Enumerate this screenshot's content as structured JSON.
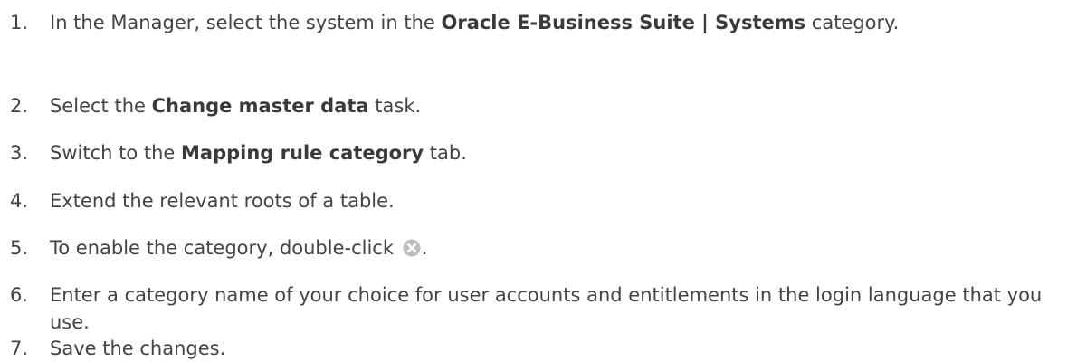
{
  "steps": [
    {
      "number": "1.",
      "text_before": "In the Manager, select the system in the ",
      "bold": "Oracle E-Business Suite | Systems",
      "text_after": " category."
    },
    {
      "number": "2.",
      "text_before": "Select the ",
      "bold": "Change master data",
      "text_after": " task."
    },
    {
      "number": "3.",
      "text_before": "Switch to the ",
      "bold": "Mapping rule category",
      "text_after": " tab."
    },
    {
      "number": "4.",
      "text": "Extend the relevant roots of a table."
    },
    {
      "number": "5.",
      "text_before": "To enable the category, double-click ",
      "icon": "disabled-x-circle-icon",
      "text_after": "."
    },
    {
      "number": "6.",
      "text": "Enter a category name of your choice for user accounts and entitlements in the login language that you use."
    },
    {
      "number": "7.",
      "text": "Save the changes."
    }
  ],
  "colors": {
    "text": "#434343",
    "icon_fill": "#bdbdbd",
    "icon_mark": "#ffffff"
  }
}
